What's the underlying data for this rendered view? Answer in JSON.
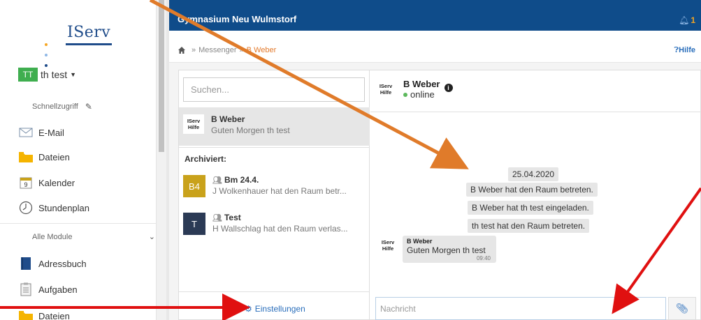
{
  "sidebar": {
    "logo_text": "IServ",
    "logo_dot_colors": [
      "#f5a623",
      "#8fb8e6",
      "#1f4c8a"
    ],
    "user_initials": "TT",
    "user_name": "th test",
    "quick_access_label": "Schnellzugriff",
    "quick_items": [
      {
        "label": "E-Mail",
        "icon": "envelope-icon"
      },
      {
        "label": "Dateien",
        "icon": "folder-icon"
      },
      {
        "label": "Kalender",
        "icon": "calendar-icon",
        "day": "9"
      },
      {
        "label": "Stundenplan",
        "icon": "clock-icon"
      }
    ],
    "all_modules_label": "Alle Module",
    "module_items": [
      {
        "label": "Adressbuch",
        "icon": "addressbook-icon"
      },
      {
        "label": "Aufgaben",
        "icon": "tasks-icon"
      },
      {
        "label": "Dateien",
        "icon": "folder-icon"
      }
    ]
  },
  "topbar": {
    "school": "Gymnasium Neu Wulmstorf",
    "notification_count": "1"
  },
  "breadcrumb": {
    "home_icon": "home-icon",
    "parent": "Messenger",
    "current": "B Weber",
    "help": "Hilfe"
  },
  "messenger": {
    "search_placeholder": "Suchen...",
    "active_conversation": {
      "name": "B Weber",
      "preview": "Guten Morgen th test",
      "avatar_line1": "IServ",
      "avatar_line2": "Hilfe"
    },
    "archived_label": "Archiviert:",
    "archived": [
      {
        "initials": "B4",
        "color": "#c9a21b",
        "name": "Bm 24.4.",
        "preview": "J Wolkenhauer hat den Raum betr..."
      },
      {
        "initials": "T",
        "color": "#2b3a55",
        "name": "Test",
        "preview": "H Wallschlag hat den Raum verlas..."
      }
    ],
    "settings_label": "Einstellungen",
    "chat": {
      "partner": "B Weber",
      "status": "online",
      "date": "25.04.2020",
      "system_messages": [
        "B Weber hat den Raum betreten.",
        "B Weber hat th test eingeladen.",
        "th test hat den Raum betreten."
      ],
      "message": {
        "sender": "B Weber",
        "text": "Guten Morgen th test",
        "time": "09:40"
      },
      "input_placeholder": "Nachricht"
    }
  },
  "colors": {
    "topbar": "#0f4c8a",
    "online": "#5cb85c",
    "breadcrumb_active": "#e37a2c",
    "annotation_orange": "#e07b2a",
    "annotation_red": "#e01010"
  }
}
